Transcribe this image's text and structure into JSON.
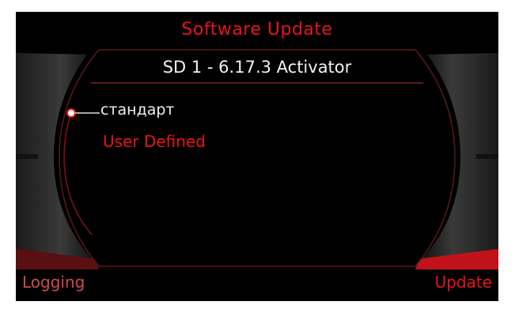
{
  "header": {
    "title": "Software Update"
  },
  "panel": {
    "title": "SD 1 - 6.17.3 Activator"
  },
  "menu": {
    "items": [
      {
        "label": "стандарт",
        "selected": true
      },
      {
        "label": "User Defined",
        "selected": false
      }
    ]
  },
  "softkeys": {
    "left": "Logging",
    "right": "Update"
  },
  "colors": {
    "accent": "#e8141c",
    "background": "#000000",
    "text": "#f0f0f0"
  }
}
